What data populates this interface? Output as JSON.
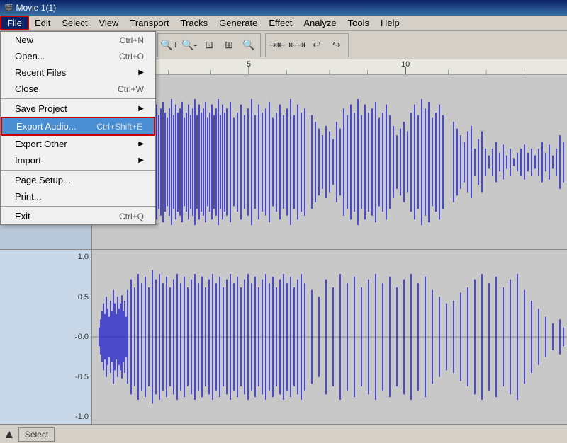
{
  "title_bar": {
    "icon": "🎬",
    "title": "Movie 1(1)"
  },
  "menu_bar": {
    "items": [
      {
        "id": "file",
        "label": "File",
        "active": true
      },
      {
        "id": "edit",
        "label": "Edit"
      },
      {
        "id": "select",
        "label": "Select"
      },
      {
        "id": "view",
        "label": "View"
      },
      {
        "id": "transport",
        "label": "Transport"
      },
      {
        "id": "tracks",
        "label": "Tracks"
      },
      {
        "id": "generate",
        "label": "Generate"
      },
      {
        "id": "effect",
        "label": "Effect"
      },
      {
        "id": "analyze",
        "label": "Analyze"
      },
      {
        "id": "tools",
        "label": "Tools"
      },
      {
        "id": "help",
        "label": "Help"
      }
    ]
  },
  "file_menu": {
    "items": [
      {
        "id": "new",
        "label": "New",
        "shortcut": "Ctrl+N",
        "has_arrow": false,
        "separator_after": false
      },
      {
        "id": "open",
        "label": "Open...",
        "shortcut": "Ctrl+O",
        "has_arrow": false,
        "separator_after": false
      },
      {
        "id": "recent_files",
        "label": "Recent Files",
        "shortcut": "",
        "has_arrow": true,
        "separator_after": false
      },
      {
        "id": "close",
        "label": "Close",
        "shortcut": "Ctrl+W",
        "has_arrow": false,
        "separator_after": true
      },
      {
        "id": "save_project",
        "label": "Save Project",
        "shortcut": "",
        "has_arrow": true,
        "separator_after": false
      },
      {
        "id": "export_audio",
        "label": "Export Audio...",
        "shortcut": "Ctrl+Shift+E",
        "has_arrow": false,
        "separator_after": false,
        "highlighted": true
      },
      {
        "id": "export_other",
        "label": "Export Other",
        "shortcut": "",
        "has_arrow": true,
        "separator_after": false
      },
      {
        "id": "import",
        "label": "Import",
        "shortcut": "",
        "has_arrow": true,
        "separator_after": true
      },
      {
        "id": "page_setup",
        "label": "Page Setup...",
        "shortcut": "",
        "has_arrow": false,
        "separator_after": false
      },
      {
        "id": "print",
        "label": "Print...",
        "shortcut": "",
        "has_arrow": false,
        "separator_after": true
      },
      {
        "id": "exit",
        "label": "Exit",
        "shortcut": "Ctrl+Q",
        "has_arrow": false,
        "separator_after": false
      }
    ]
  },
  "ruler": {
    "marks": [
      "5",
      "10"
    ]
  },
  "bottom_bar": {
    "select_label": "Select"
  },
  "scale": {
    "track2_labels": [
      "1.0",
      "0.5",
      "0.0",
      "-0.5",
      "-1.0"
    ]
  }
}
